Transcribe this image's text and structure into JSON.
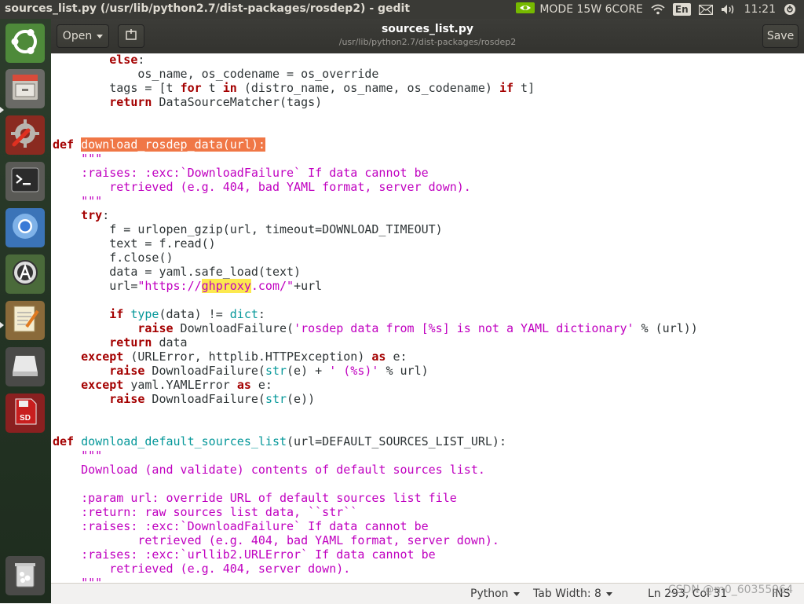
{
  "window_title": "sources_list.py (/usr/lib/python2.7/dist-packages/rosdep2) - gedit",
  "top_panel": {
    "power_mode": "MODE 15W 6CORE",
    "language": "En",
    "clock": "11:21"
  },
  "launcher": {
    "items": [
      "ubuntu-dash",
      "file-manager",
      "system-settings",
      "terminal",
      "chromium",
      "software-updater",
      "text-editor",
      "removable-drive",
      "sd-card",
      "trash"
    ]
  },
  "headerbar": {
    "open_label": "Open",
    "title": "sources_list.py",
    "path": "/usr/lib/python2.7/dist-packages/rosdep2",
    "save_label": "Save"
  },
  "code_lines": [
    [
      [
        "        ",
        ""
      ],
      [
        "else",
        "kw"
      ],
      [
        ":",
        ""
      ]
    ],
    [
      [
        "            os_name, os_codename = os_override",
        ""
      ]
    ],
    [
      [
        "        tags = [t ",
        ""
      ],
      [
        "for",
        "kw"
      ],
      [
        " t ",
        ""
      ],
      [
        "in",
        "kw"
      ],
      [
        " (distro_name, os_name, os_codename) ",
        ""
      ],
      [
        "if",
        "kw"
      ],
      [
        " t]",
        ""
      ]
    ],
    [
      [
        "        ",
        ""
      ],
      [
        "return",
        "kw"
      ],
      [
        " DataSourceMatcher(tags)",
        ""
      ]
    ],
    [],
    [],
    [
      [
        "def",
        "kw"
      ],
      [
        " ",
        ""
      ],
      [
        "download_rosdep_data(url):",
        "sel"
      ]
    ],
    [
      [
        "    ",
        ""
      ],
      [
        "\"\"\"",
        "st"
      ]
    ],
    [
      [
        "    ",
        ""
      ],
      [
        ":raises: :exc:`DownloadFailure` If data cannot be",
        "st"
      ]
    ],
    [
      [
        "        ",
        ""
      ],
      [
        "retrieved (e.g. 404, bad YAML format, server down).",
        "st"
      ]
    ],
    [
      [
        "    ",
        ""
      ],
      [
        "\"\"\"",
        "st"
      ]
    ],
    [
      [
        "    ",
        ""
      ],
      [
        "try",
        "kw"
      ],
      [
        ":",
        ""
      ]
    ],
    [
      [
        "        f = urlopen_gzip(url, timeout=DOWNLOAD_TIMEOUT)",
        ""
      ]
    ],
    [
      [
        "        text = f.read()",
        ""
      ]
    ],
    [
      [
        "        f.close()",
        ""
      ]
    ],
    [
      [
        "        data = yaml.safe_load(text)",
        ""
      ]
    ],
    [
      [
        "        url=",
        ""
      ],
      [
        "\"https://",
        "st"
      ],
      [
        "ghproxy",
        "hl"
      ],
      [
        ".com/\"",
        "st"
      ],
      [
        "+url",
        ""
      ]
    ],
    [],
    [
      [
        "        ",
        ""
      ],
      [
        "if",
        "kw"
      ],
      [
        " ",
        ""
      ],
      [
        "type",
        "fn"
      ],
      [
        "(data) != ",
        ""
      ],
      [
        "dict",
        "fn"
      ],
      [
        ":",
        ""
      ]
    ],
    [
      [
        "            ",
        ""
      ],
      [
        "raise",
        "kw"
      ],
      [
        " DownloadFailure(",
        ""
      ],
      [
        "'rosdep data from [%s] is not a YAML dictionary'",
        "st"
      ],
      [
        " % (url))",
        ""
      ]
    ],
    [
      [
        "        ",
        ""
      ],
      [
        "return",
        "kw"
      ],
      [
        " data",
        ""
      ]
    ],
    [
      [
        "    ",
        ""
      ],
      [
        "except",
        "kw"
      ],
      [
        " (URLError, httplib.HTTPException) ",
        ""
      ],
      [
        "as",
        "kw"
      ],
      [
        " e:",
        ""
      ]
    ],
    [
      [
        "        ",
        ""
      ],
      [
        "raise",
        "kw"
      ],
      [
        " DownloadFailure(",
        ""
      ],
      [
        "str",
        "fn"
      ],
      [
        "(e) + ",
        ""
      ],
      [
        "' (%s)'",
        "st"
      ],
      [
        " % url)",
        ""
      ]
    ],
    [
      [
        "    ",
        ""
      ],
      [
        "except",
        "kw"
      ],
      [
        " yaml.YAMLError ",
        ""
      ],
      [
        "as",
        "kw"
      ],
      [
        " e:",
        ""
      ]
    ],
    [
      [
        "        ",
        ""
      ],
      [
        "raise",
        "kw"
      ],
      [
        " DownloadFailure(",
        ""
      ],
      [
        "str",
        "fn"
      ],
      [
        "(e))",
        ""
      ]
    ],
    [],
    [],
    [
      [
        "def",
        "kw"
      ],
      [
        " ",
        ""
      ],
      [
        "download_default_sources_list",
        "fn"
      ],
      [
        "(url=DEFAULT_SOURCES_LIST_URL):",
        ""
      ]
    ],
    [
      [
        "    ",
        ""
      ],
      [
        "\"\"\"",
        "st"
      ]
    ],
    [
      [
        "    ",
        ""
      ],
      [
        "Download (and validate) contents of default sources list.",
        "st"
      ]
    ],
    [],
    [
      [
        "    ",
        ""
      ],
      [
        ":param url: override URL of default sources list file",
        "st"
      ]
    ],
    [
      [
        "    ",
        ""
      ],
      [
        ":return: raw sources list data, ``str``",
        "st"
      ]
    ],
    [
      [
        "    ",
        ""
      ],
      [
        ":raises: :exc:`DownloadFailure` If data cannot be",
        "st"
      ]
    ],
    [
      [
        "            ",
        ""
      ],
      [
        "retrieved (e.g. 404, bad YAML format, server down).",
        "st"
      ]
    ],
    [
      [
        "    ",
        ""
      ],
      [
        ":raises: :exc:`urllib2.URLError` If data cannot be",
        "st"
      ]
    ],
    [
      [
        "        ",
        ""
      ],
      [
        "retrieved (e.g. 404, server down).",
        "st"
      ]
    ],
    [
      [
        "    ",
        ""
      ],
      [
        "\"\"\"",
        "st"
      ]
    ]
  ],
  "statusbar": {
    "language": "Python",
    "tab_width": "Tab Width: 8",
    "position": "Ln 293, Col 31",
    "mode": "INS"
  },
  "watermark": "CSDN @m0_60355964"
}
